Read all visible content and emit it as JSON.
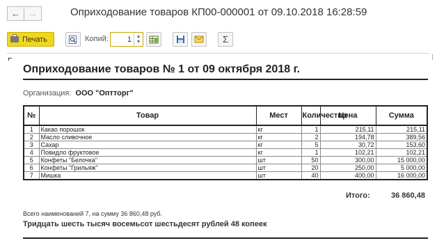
{
  "window": {
    "title": "Оприходование товаров КП00-000001 от 09.10.2018 16:28:59"
  },
  "nav": {
    "back_icon": "←",
    "forward_icon": "→"
  },
  "toolbar": {
    "print_label": "Печать",
    "copies_label": "Копий:",
    "copies_value": "1",
    "sum_icon": "Σ"
  },
  "document": {
    "title": "Оприходование товаров № 1 от 09 октября 2018 г.",
    "org_label": "Организация:",
    "org_value": "ООО \"Оптторг\"",
    "columns": [
      "№",
      "Товар",
      "Мест",
      "Количество",
      "Цена",
      "Сумма"
    ],
    "rows": [
      {
        "n": "1",
        "name": "Какао порошок",
        "unit1": "кг",
        "qty": "1",
        "unit2": "кг",
        "price": "215,11",
        "sum": "215,11"
      },
      {
        "n": "2",
        "name": "Масло сливочное",
        "unit1": "кг",
        "qty": "2",
        "unit2": "кг",
        "price": "194,78",
        "sum": "389,56"
      },
      {
        "n": "3",
        "name": "Сахар",
        "unit1": "кг",
        "qty": "5",
        "unit2": "кг",
        "price": "30,72",
        "sum": "153,60"
      },
      {
        "n": "4",
        "name": "Повидло фруктовое",
        "unit1": "кг",
        "qty": "1",
        "unit2": "кг",
        "price": "102,21",
        "sum": "102,21"
      },
      {
        "n": "5",
        "name": "Конфеты \"Белочка\"",
        "unit1": "шт",
        "qty": "50",
        "unit2": "шт",
        "price": "300,00",
        "sum": "15 000,00"
      },
      {
        "n": "6",
        "name": "Конфеты \"Грильяж\"",
        "unit1": "шт",
        "qty": "20",
        "unit2": "шт",
        "price": "250,00",
        "sum": "5 000,00"
      },
      {
        "n": "7",
        "name": "Мишка",
        "unit1": "шт",
        "qty": "40",
        "unit2": "шт",
        "price": "400,00",
        "sum": "16 000,00"
      }
    ],
    "total_label": "Итого:",
    "total_value": "36 860,48",
    "summary": "Всего наименований 7, на сумму 36 860,48 руб.",
    "amount_words": "Тридцать шесть тысяч восемьсот шестьдесят рублей 48 копеек"
  }
}
